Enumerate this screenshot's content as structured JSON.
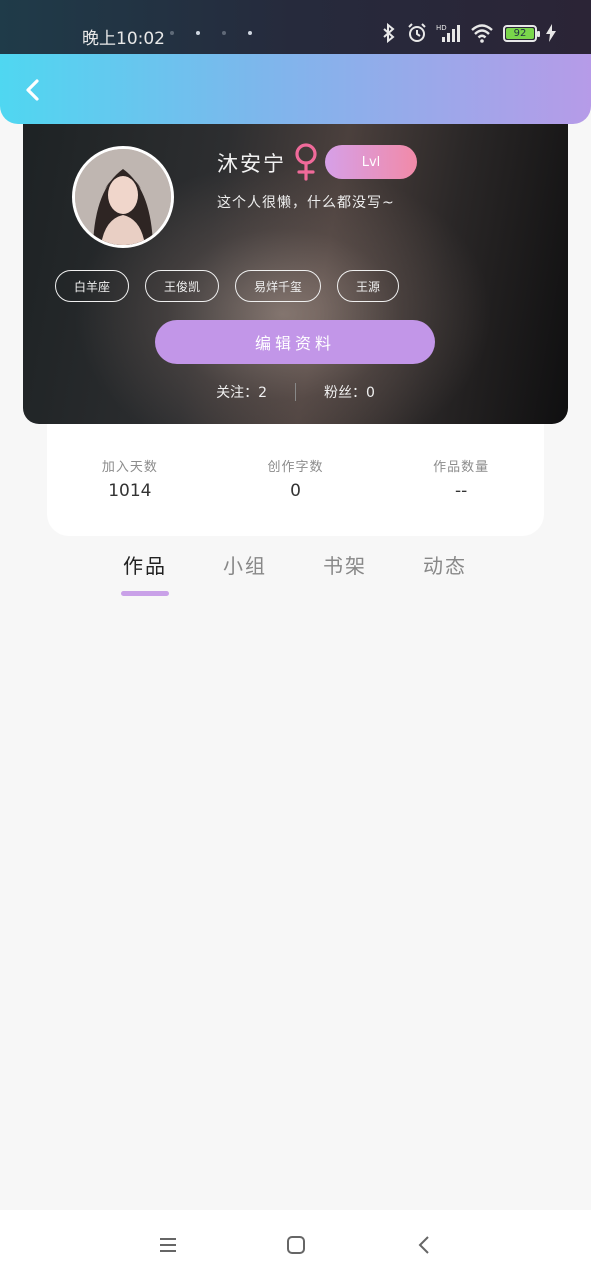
{
  "status_bar": {
    "time": "晚上10:02",
    "battery_level": "92",
    "icons": [
      "bluetooth-icon",
      "alarm-icon",
      "signal-icon",
      "wifi-icon",
      "battery-icon",
      "charging-icon"
    ]
  },
  "header": {
    "back_icon": "chevron-left-icon",
    "gradient_start": "#4fd7f1",
    "gradient_end": "#b69be8"
  },
  "profile": {
    "username": "沐安宁",
    "gender_symbol": "♀",
    "level": "Lvl",
    "bio": "这个人很懒，什么都没写~",
    "tags": [
      "白羊座",
      "王俊凯",
      "易烊千玺",
      "王源"
    ],
    "edit_button": "编辑资料",
    "following_label": "关注：2",
    "followers_label": "粉丝：0"
  },
  "stats": [
    {
      "label": "加入天数",
      "value": "1014"
    },
    {
      "label": "创作字数",
      "value": "0"
    },
    {
      "label": "作品数量",
      "value": "--"
    }
  ],
  "tabs": [
    {
      "label": "作品",
      "active": true
    },
    {
      "label": "小组",
      "active": false
    },
    {
      "label": "书架",
      "active": false
    },
    {
      "label": "动态",
      "active": false
    }
  ],
  "nav_bar": {
    "icons": [
      "menu-icon",
      "home-square-icon",
      "back-triangle-icon"
    ]
  },
  "colors": {
    "accent_purple": "#c296e8",
    "badge_pink": "#f18aa8",
    "gender_pink": "#f06a9a"
  }
}
